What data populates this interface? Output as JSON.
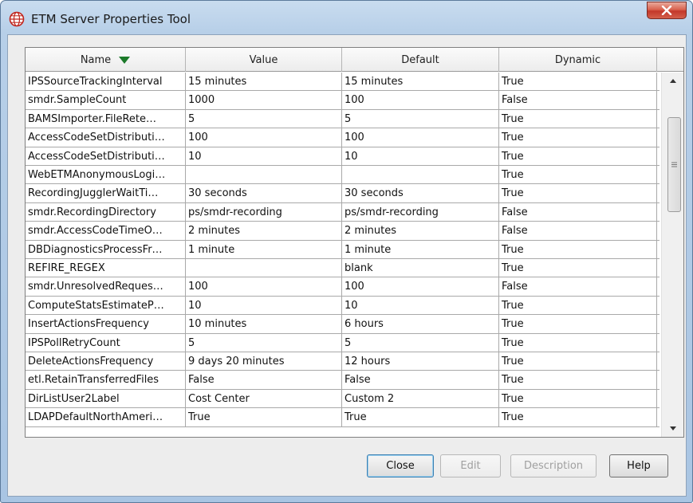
{
  "window": {
    "title": "ETM Server Properties Tool"
  },
  "table": {
    "columns": {
      "name": "Name",
      "value": "Value",
      "default": "Default",
      "dynamic": "Dynamic"
    },
    "sort": {
      "column": "Name",
      "direction": "descending"
    },
    "rows": [
      [
        "IPSSourceTrackingInterval",
        "15 minutes",
        "15 minutes",
        "True"
      ],
      [
        "smdr.SampleCount",
        "1000",
        "100",
        "False"
      ],
      [
        "BAMSImporter.FileRete…",
        "5",
        "5",
        "True"
      ],
      [
        "AccessCodeSetDistributi…",
        "100",
        "100",
        "True"
      ],
      [
        "AccessCodeSetDistributi…",
        "10",
        "10",
        "True"
      ],
      [
        "WebETMAnonymousLogi…",
        "",
        "",
        "True"
      ],
      [
        "RecordingJugglerWaitTi…",
        "30 seconds",
        "30 seconds",
        "True"
      ],
      [
        "smdr.RecordingDirectory",
        "ps/smdr-recording",
        "ps/smdr-recording",
        "False"
      ],
      [
        "smdr.AccessCodeTimeO…",
        "2 minutes",
        "2 minutes",
        "False"
      ],
      [
        "DBDiagnosticsProcessFr…",
        "1 minute",
        "1 minute",
        "True"
      ],
      [
        "REFIRE_REGEX",
        "",
        "blank",
        "True"
      ],
      [
        "smdr.UnresolvedReques…",
        "100",
        "100",
        "False"
      ],
      [
        "ComputeStatsEstimateP…",
        "10",
        "10",
        "True"
      ],
      [
        "InsertActionsFrequency",
        "10 minutes",
        "6 hours",
        "True"
      ],
      [
        "IPSPollRetryCount",
        "5",
        "5",
        "True"
      ],
      [
        "DeleteActionsFrequency",
        "9 days 20 minutes",
        "12 hours",
        "True"
      ],
      [
        "etl.RetainTransferredFiles",
        "False",
        "False",
        "True"
      ],
      [
        "DirListUser2Label",
        "Cost Center",
        "Custom 2",
        "True"
      ],
      [
        "LDAPDefaultNorthAmeri…",
        "True",
        "True",
        "True"
      ]
    ]
  },
  "scrollbar": {
    "position_fraction": 0.0
  },
  "buttons": {
    "close": "Close",
    "edit": "Edit",
    "description": "Description",
    "help": "Help"
  },
  "icons": {
    "app": "globe-icon",
    "title_close": "close-icon",
    "sort": "sort-descending-icon"
  },
  "colors": {
    "title_bar": "#b7cfe8",
    "close_button": "#c3382a",
    "sort_arrow": "#1c7a2a"
  }
}
